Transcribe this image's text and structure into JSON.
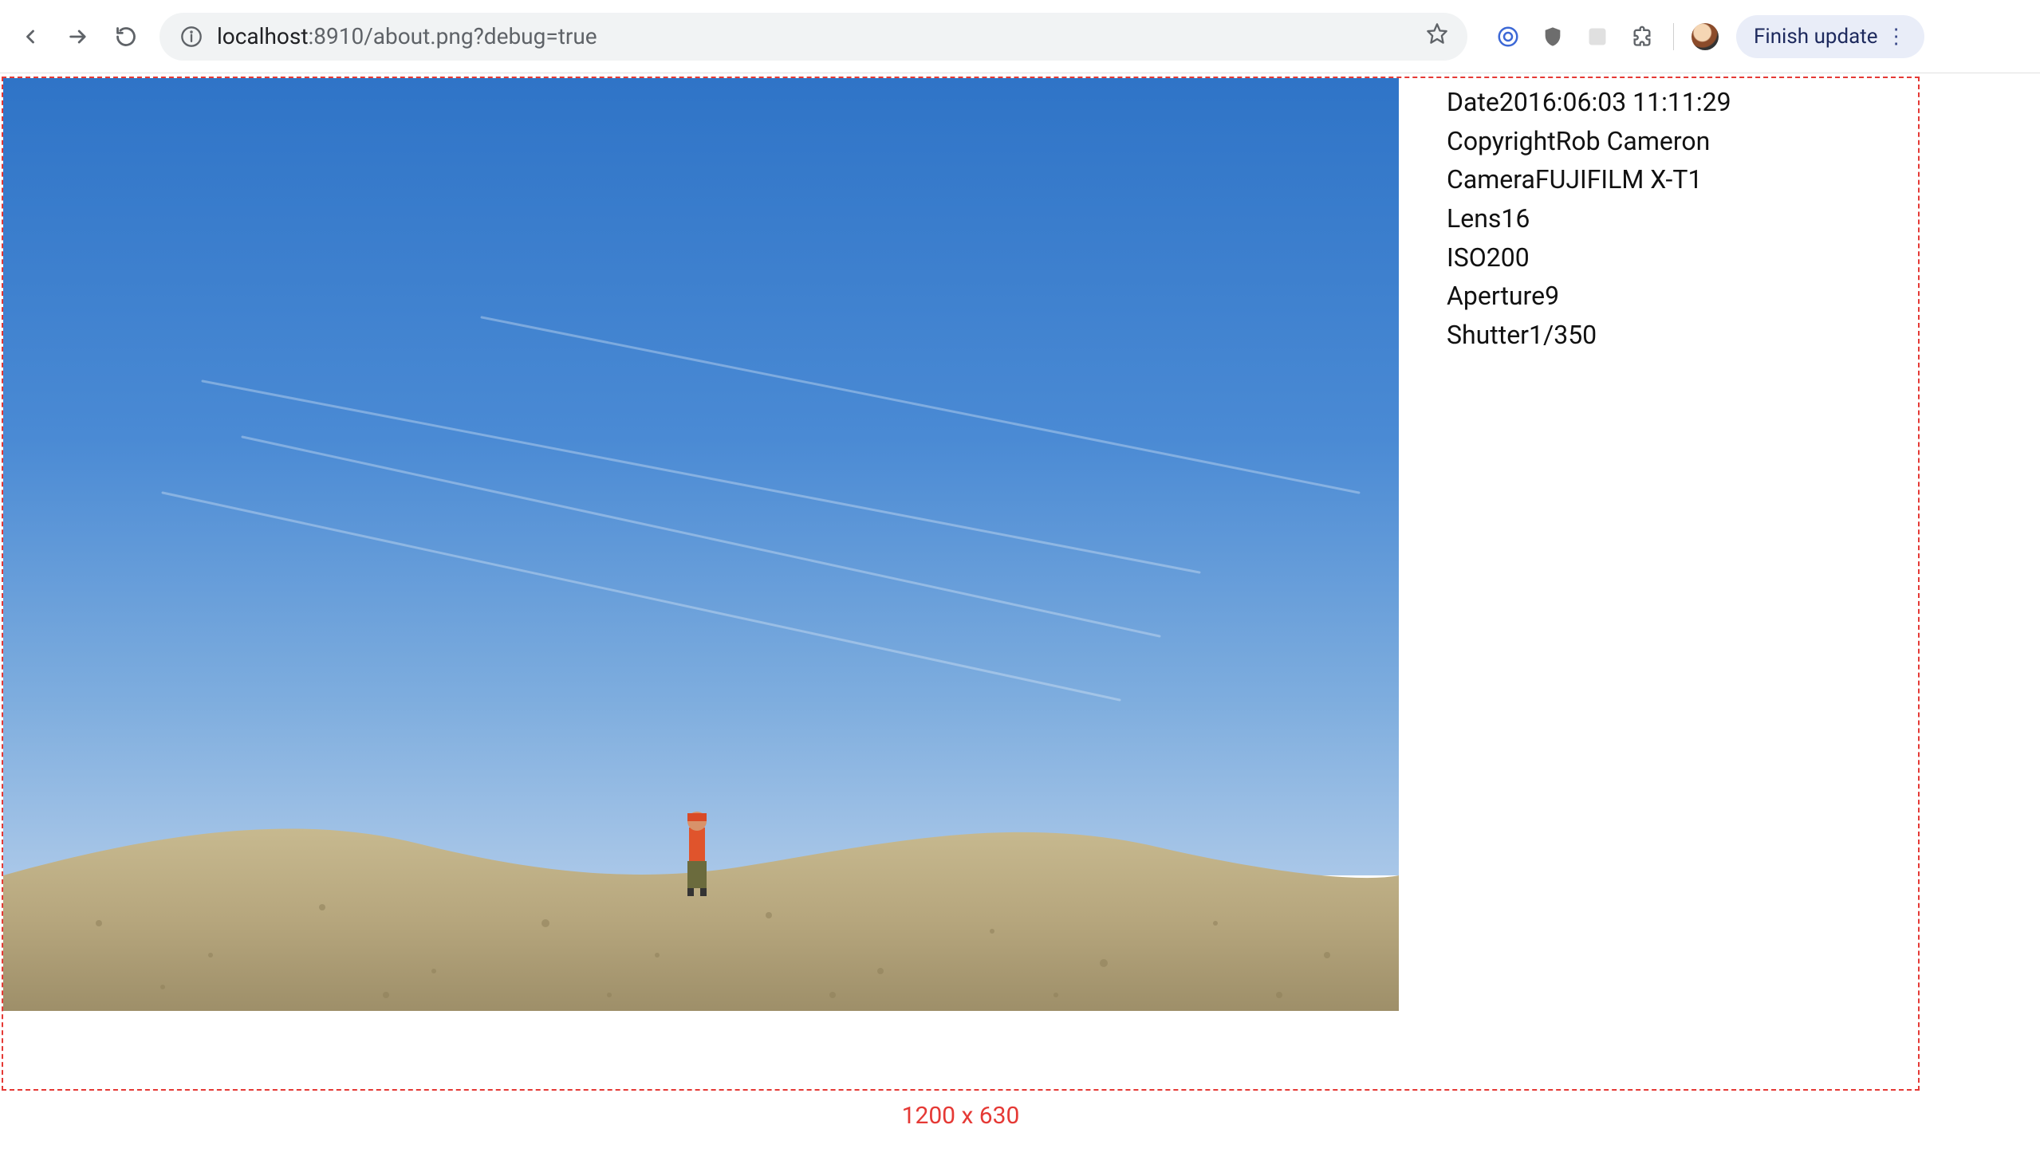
{
  "browser": {
    "url_host": "localhost",
    "url_rest": ":8910/about.png?debug=true",
    "finish_update_label": "Finish update"
  },
  "metadata": {
    "Date": "2016:06:03 11:11:29",
    "Copyright": "Rob Cameron",
    "Camera": "FUJIFILM X-T1",
    "Lens": "16",
    "ISO": "200",
    "Aperture": "9",
    "Shutter": "1/350"
  },
  "dims": "1200 x 630"
}
